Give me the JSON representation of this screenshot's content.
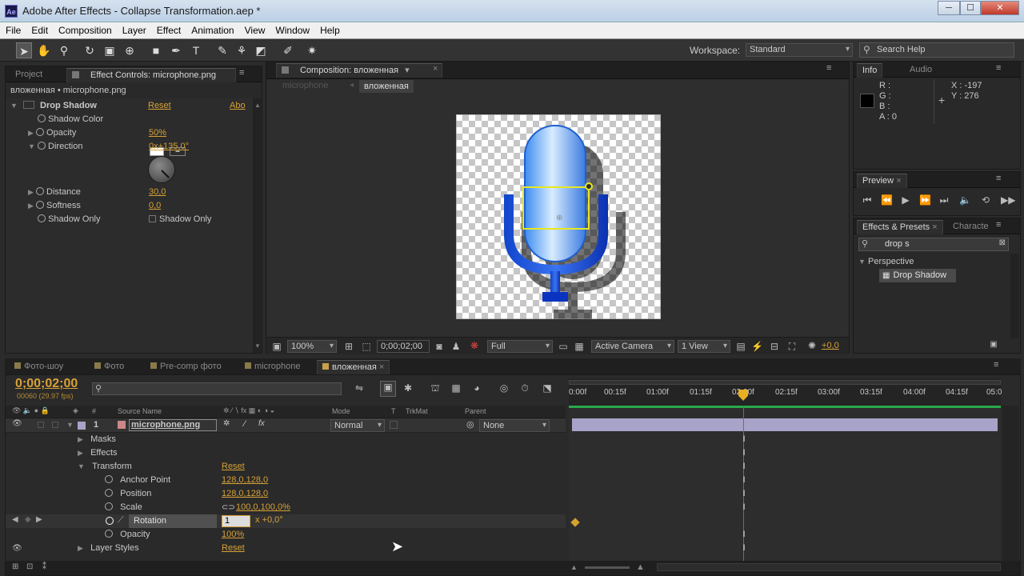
{
  "window": {
    "app_icon_text": "Ae",
    "title": "Adobe After Effects - Collapse Transformation.aep *",
    "buttons": [
      "─",
      "☐",
      "✕"
    ]
  },
  "menu": [
    "File",
    "Edit",
    "Composition",
    "Layer",
    "Effect",
    "Animation",
    "View",
    "Window",
    "Help"
  ],
  "toolbar": {
    "workspace_label": "Workspace:",
    "workspace_value": "Standard",
    "search_placeholder": "Search Help"
  },
  "effect_controls": {
    "tab_project": "Project",
    "tab_title": "Effect Controls: microphone.png",
    "breadcrumb": "вложенная • microphone.png",
    "effect_name": "Drop Shadow",
    "reset": "Reset",
    "about": "Abo",
    "props": [
      {
        "label": "Shadow Color",
        "value": ""
      },
      {
        "label": "Opacity",
        "value": "50%"
      },
      {
        "label": "Direction",
        "value": "0x+135,0°"
      },
      {
        "label": "Distance",
        "value": "30,0"
      },
      {
        "label": "Softness",
        "value": "0,0"
      },
      {
        "label": "Shadow Only",
        "value": "Shadow Only"
      }
    ]
  },
  "composition": {
    "tab_title": "Composition: вложенная",
    "nav_prev": "microphone",
    "nav_current": "вложенная",
    "zoom": "100%",
    "timecode": "0;00;02;00",
    "resolution": "Full",
    "camera": "Active Camera",
    "views": "1 View",
    "exposure": "+0,0"
  },
  "info": {
    "tab": "Info",
    "tab2": "Audio",
    "r": "R :",
    "g": "G :",
    "b": "B :",
    "a": "A : 0",
    "x": "X : -197",
    "y": "Y : 276"
  },
  "preview": {
    "tab": "Preview"
  },
  "effects_presets": {
    "tab": "Effects & Presets",
    "tab2": "Characte",
    "search": "drop s",
    "category": "Perspective",
    "item": "Drop Shadow"
  },
  "timeline": {
    "tabs": [
      "Фото-шоу",
      "Фото",
      "Pre-comp фото",
      "microphone",
      "вложенная"
    ],
    "timecode": "0;00;02;00",
    "fps": "00060 (29.97 fps)",
    "col_source": "Source Name",
    "col_mode": "Mode",
    "col_t": "T",
    "col_trkmat": "TrkMat",
    "col_parent": "Parent",
    "col_hash": "#",
    "layer_num": "1",
    "layer_name": "microphone.png",
    "layer_mode": "Normal",
    "layer_parent": "None",
    "ruler": [
      "0:00f",
      "00:15f",
      "01:00f",
      "01:15f",
      "02:00f",
      "02:15f",
      "03:00f",
      "03:15f",
      "04:00f",
      "04:15f",
      "05:0"
    ],
    "rows": [
      {
        "label": "Masks",
        "value": ""
      },
      {
        "label": "Effects",
        "value": ""
      },
      {
        "label": "Transform",
        "value": "Reset"
      },
      {
        "label": "Anchor Point",
        "value": "128,0,128,0"
      },
      {
        "label": "Position",
        "value": "128,0,128,0"
      },
      {
        "label": "Scale",
        "value": "100,0,100,0%"
      },
      {
        "label": "Rotation",
        "value": "x +0,0°",
        "input": "1"
      },
      {
        "label": "Opacity",
        "value": "100%"
      },
      {
        "label": "Layer Styles",
        "value": "Reset"
      }
    ]
  },
  "colors": {
    "accent": "#d7a136",
    "layer_bar": "#a8a3c8",
    "playhead": "#d84040"
  }
}
